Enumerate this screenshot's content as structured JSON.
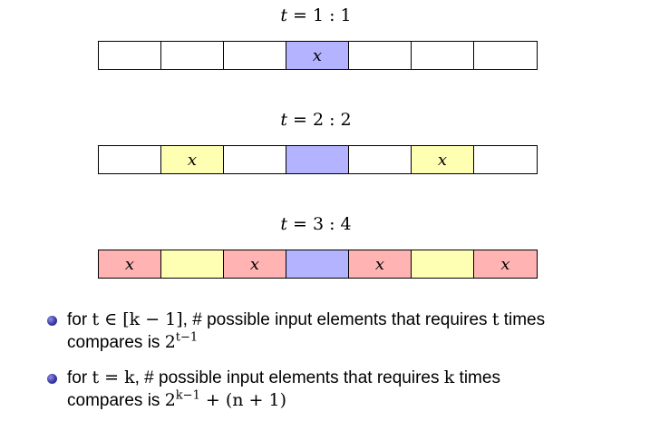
{
  "colors": {
    "empty": "#ffffff",
    "center": "#b3b3ff",
    "level2": "#ffffb3",
    "level3": "#ffb3b3",
    "border": "#000000",
    "bullet": "#3a3aa8"
  },
  "rows": [
    {
      "label": {
        "var": "t",
        "eq": " = 1 : 1"
      },
      "cells": [
        {
          "fill": "empty",
          "text": ""
        },
        {
          "fill": "empty",
          "text": ""
        },
        {
          "fill": "empty",
          "text": ""
        },
        {
          "fill": "center",
          "text": "x"
        },
        {
          "fill": "empty",
          "text": ""
        },
        {
          "fill": "empty",
          "text": ""
        },
        {
          "fill": "empty",
          "text": ""
        }
      ]
    },
    {
      "label": {
        "var": "t",
        "eq": " = 2 : 2"
      },
      "cells": [
        {
          "fill": "empty",
          "text": ""
        },
        {
          "fill": "level2",
          "text": "x"
        },
        {
          "fill": "empty",
          "text": ""
        },
        {
          "fill": "center",
          "text": ""
        },
        {
          "fill": "empty",
          "text": ""
        },
        {
          "fill": "level2",
          "text": "x"
        },
        {
          "fill": "empty",
          "text": ""
        }
      ]
    },
    {
      "label": {
        "var": "t",
        "eq": " = 3 : 4"
      },
      "cells": [
        {
          "fill": "level3",
          "text": "x"
        },
        {
          "fill": "level2",
          "text": ""
        },
        {
          "fill": "level3",
          "text": "x"
        },
        {
          "fill": "center",
          "text": ""
        },
        {
          "fill": "level3",
          "text": "x"
        },
        {
          "fill": "level2",
          "text": ""
        },
        {
          "fill": "level3",
          "text": "x"
        }
      ]
    }
  ],
  "bullets": {
    "first": {
      "lead": "for ",
      "cond": "t ∈ [k − 1]",
      "mid": ", # possible input elements that requires ",
      "var": "t",
      "tail": " times",
      "line2": "compares is ",
      "base": "2",
      "exp": "t−1",
      "after": ""
    },
    "second": {
      "lead": "for ",
      "cond": "t = k",
      "mid": ", # possible input elements that requires ",
      "var": "k",
      "tail": " times",
      "line2": "compares is ",
      "base": "2",
      "exp": "k−1",
      "after": " + (n + 1)"
    }
  }
}
